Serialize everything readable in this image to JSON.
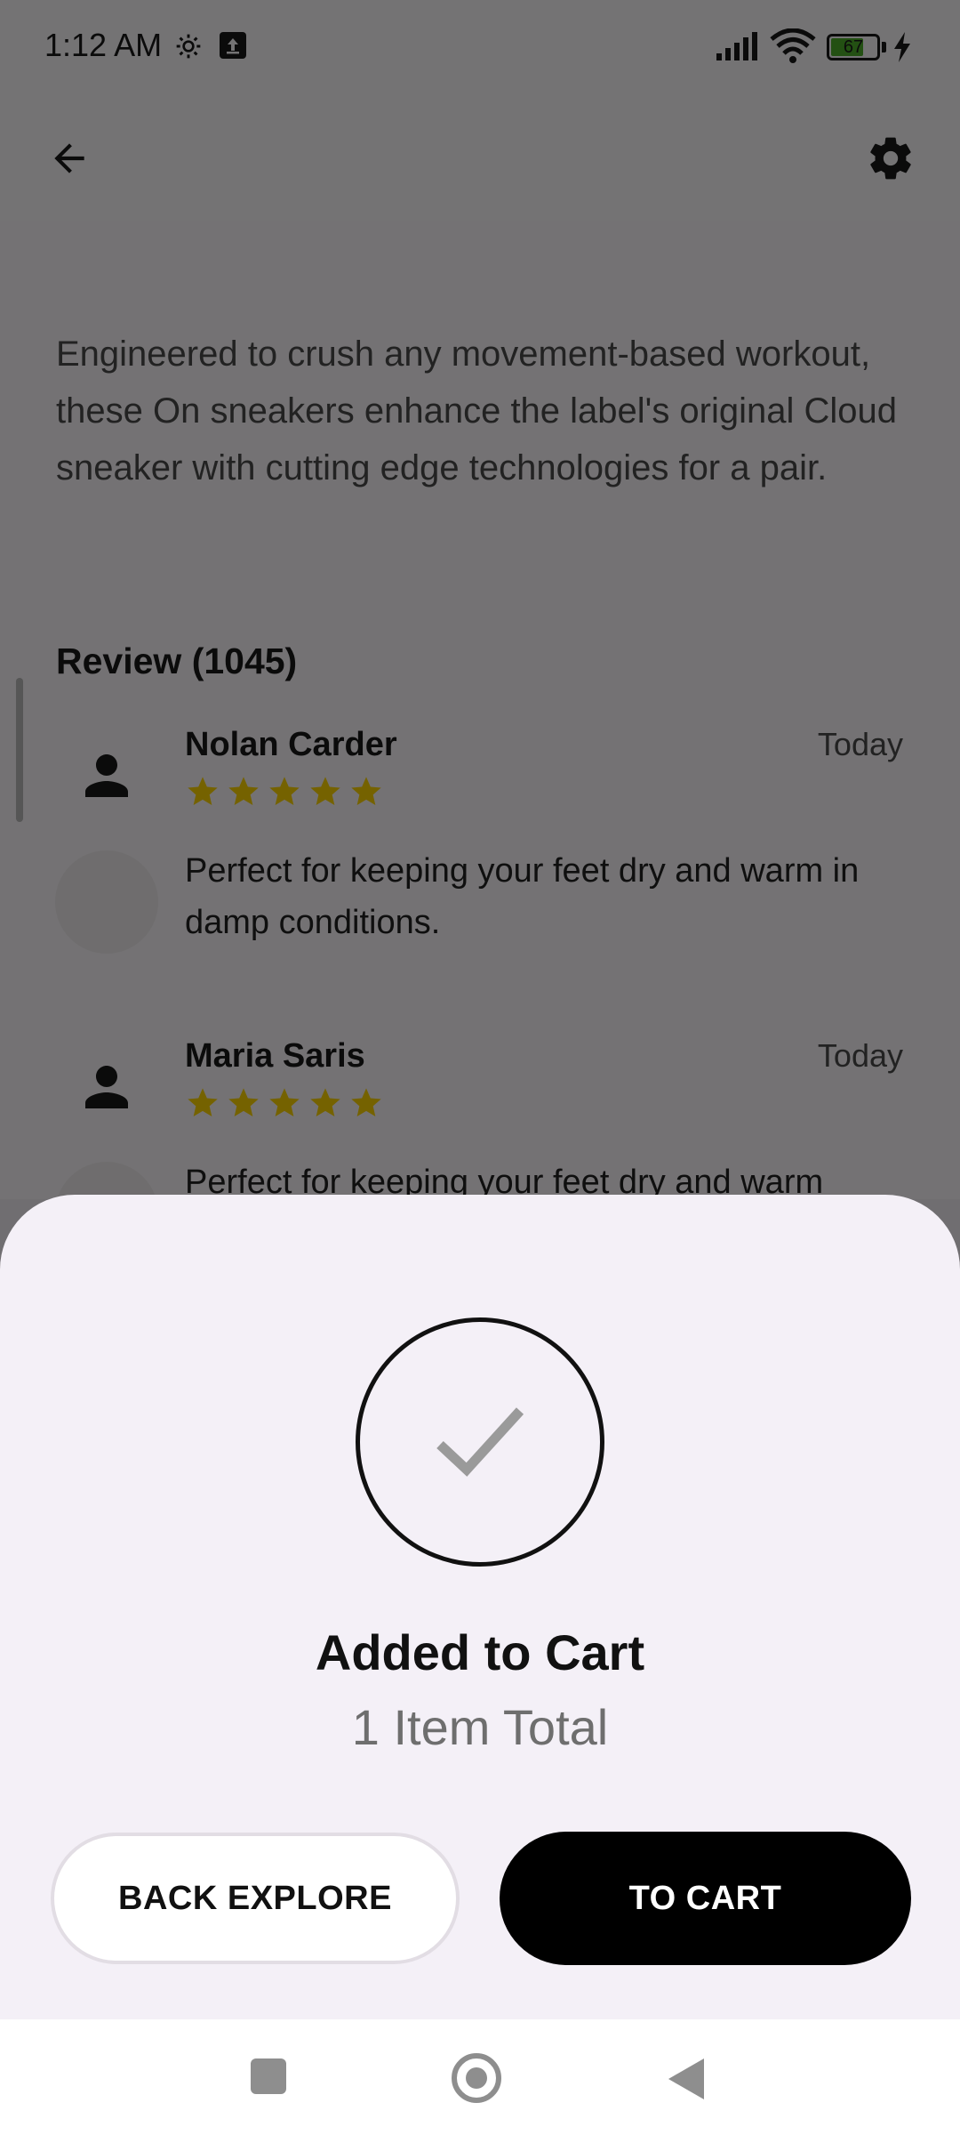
{
  "status_bar": {
    "time": "1:12 AM",
    "battery_level": "67",
    "icons": [
      "gear-icon",
      "upload-icon",
      "signal-icon",
      "wifi-icon",
      "battery-icon",
      "charging-icon"
    ]
  },
  "app_bar": {
    "back_icon": "arrow-left-icon",
    "settings_icon": "gear-icon"
  },
  "product": {
    "description": "Engineered to crush any movement-based workout, these On sneakers enhance the label's original Cloud sneaker with cutting edge technologies for a pair."
  },
  "reviews": {
    "title": "Review (1045)",
    "items": [
      {
        "name": "Nolan Carder",
        "date": "Today",
        "rating": 5,
        "text": "Perfect for keeping your feet dry and warm in damp conditions."
      },
      {
        "name": "Maria Saris",
        "date": "Today",
        "rating": 5,
        "text": "Perfect for keeping your feet dry and warm"
      }
    ]
  },
  "sheet": {
    "icon": "checkmark-icon",
    "title": "Added to Cart",
    "subtitle": "1 Item Total",
    "back_button": "BACK EXPLORE",
    "cart_button": "TO CART"
  },
  "colors": {
    "star": "#FFD600",
    "accent": "#000000",
    "sheet_bg": "#F4F0F7"
  },
  "nav_bar": {
    "icons": [
      "recents-icon",
      "home-icon",
      "back-icon"
    ]
  }
}
